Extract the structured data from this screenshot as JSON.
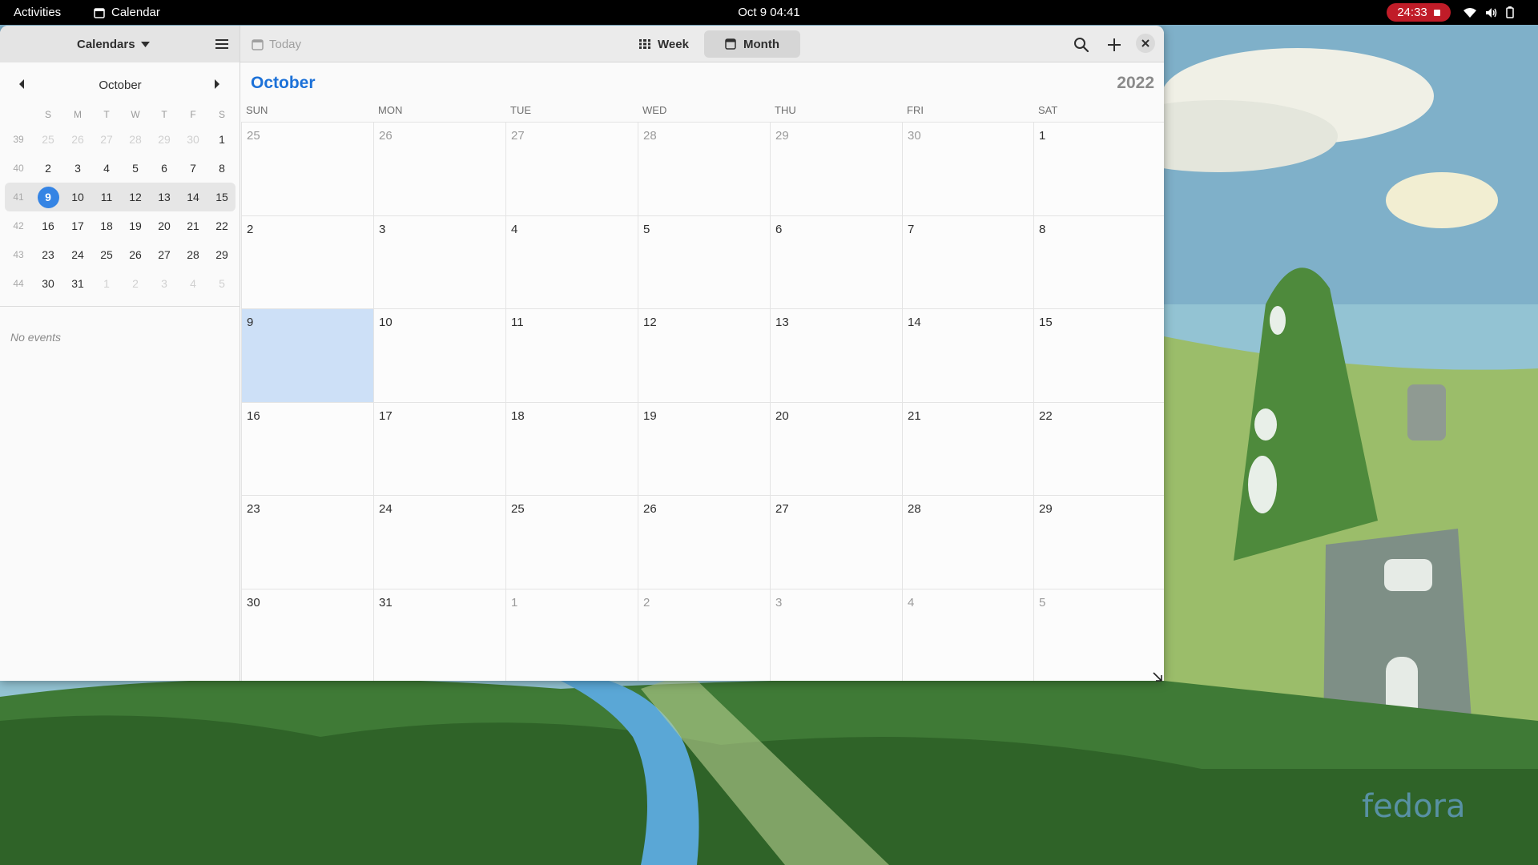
{
  "topbar": {
    "activities": "Activities",
    "app_name": "Calendar",
    "clock": "Oct 9  04:41",
    "recording_time": "24:33"
  },
  "headerbar": {
    "calendars_label": "Calendars",
    "today_label": "Today",
    "week_label": "Week",
    "month_label": "Month"
  },
  "sidebar": {
    "month": "October",
    "weekday_initials": [
      "S",
      "M",
      "T",
      "W",
      "T",
      "F",
      "S"
    ],
    "weeks": [
      {
        "num": "39",
        "days": [
          "25",
          "26",
          "27",
          "28",
          "29",
          "30",
          "1"
        ],
        "dim": [
          true,
          true,
          true,
          true,
          true,
          true,
          false
        ]
      },
      {
        "num": "40",
        "days": [
          "2",
          "3",
          "4",
          "5",
          "6",
          "7",
          "8"
        ],
        "dim": [
          false,
          false,
          false,
          false,
          false,
          false,
          false
        ]
      },
      {
        "num": "41",
        "days": [
          "9",
          "10",
          "11",
          "12",
          "13",
          "14",
          "15"
        ],
        "dim": [
          false,
          false,
          false,
          false,
          false,
          false,
          false
        ],
        "current": true,
        "selected_index": 0
      },
      {
        "num": "42",
        "days": [
          "16",
          "17",
          "18",
          "19",
          "20",
          "21",
          "22"
        ],
        "dim": [
          false,
          false,
          false,
          false,
          false,
          false,
          false
        ]
      },
      {
        "num": "43",
        "days": [
          "23",
          "24",
          "25",
          "26",
          "27",
          "28",
          "29"
        ],
        "dim": [
          false,
          false,
          false,
          false,
          false,
          false,
          false
        ]
      },
      {
        "num": "44",
        "days": [
          "30",
          "31",
          "1",
          "2",
          "3",
          "4",
          "5"
        ],
        "dim": [
          false,
          false,
          true,
          true,
          true,
          true,
          true
        ]
      }
    ],
    "no_events": "No events"
  },
  "month_view": {
    "month": "October",
    "year": "2022",
    "weekdays": [
      "SUN",
      "MON",
      "TUE",
      "WED",
      "THU",
      "FRI",
      "SAT"
    ],
    "weeks": [
      {
        "days": [
          "25",
          "26",
          "27",
          "28",
          "29",
          "30",
          "1"
        ],
        "other": [
          true,
          true,
          true,
          true,
          true,
          true,
          false
        ]
      },
      {
        "days": [
          "2",
          "3",
          "4",
          "5",
          "6",
          "7",
          "8"
        ],
        "other": [
          false,
          false,
          false,
          false,
          false,
          false,
          false
        ]
      },
      {
        "days": [
          "9",
          "10",
          "11",
          "12",
          "13",
          "14",
          "15"
        ],
        "other": [
          false,
          false,
          false,
          false,
          false,
          false,
          false
        ],
        "selected_index": 0
      },
      {
        "days": [
          "16",
          "17",
          "18",
          "19",
          "20",
          "21",
          "22"
        ],
        "other": [
          false,
          false,
          false,
          false,
          false,
          false,
          false
        ]
      },
      {
        "days": [
          "23",
          "24",
          "25",
          "26",
          "27",
          "28",
          "29"
        ],
        "other": [
          false,
          false,
          false,
          false,
          false,
          false,
          false
        ]
      },
      {
        "days": [
          "30",
          "31",
          "1",
          "2",
          "3",
          "4",
          "5"
        ],
        "other": [
          false,
          false,
          true,
          true,
          true,
          true,
          true
        ]
      }
    ]
  },
  "colors": {
    "accent": "#3584e4",
    "month_title": "#1c71d8",
    "selected_cell": "#cde0f7",
    "record_pill": "#c01c28"
  },
  "icons": [
    "calendar-app-icon",
    "caret-down-icon",
    "hamburger-menu-icon",
    "today-calendar-icon",
    "week-grid-icon",
    "month-calendar-icon",
    "search-icon",
    "plus-icon",
    "close-icon",
    "chevron-left-icon",
    "chevron-right-icon",
    "wifi-icon",
    "volume-icon",
    "battery-icon",
    "stop-recording-icon",
    "resize-grip-icon",
    "fedora-logo"
  ]
}
